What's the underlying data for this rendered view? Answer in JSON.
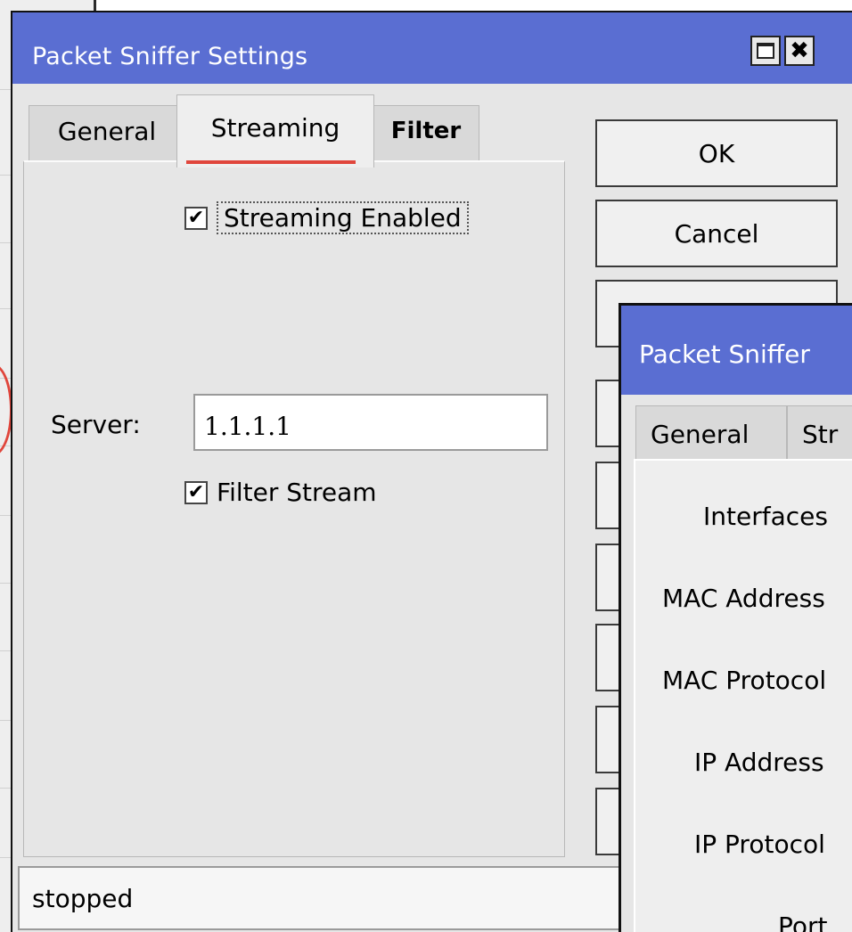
{
  "main_window": {
    "title": "Packet Sniffer Settings",
    "tabs": [
      {
        "label": "General"
      },
      {
        "label": "Streaming"
      },
      {
        "label": "Filter"
      }
    ],
    "streaming_enabled": {
      "label": "Streaming Enabled",
      "checked": true
    },
    "server": {
      "label": "Server:",
      "value": "1.1.1.1"
    },
    "filter_stream": {
      "label": "Filter Stream",
      "checked": true
    },
    "buttons": {
      "ok": "OK",
      "cancel": "Cancel"
    },
    "status": "stopped"
  },
  "second_window": {
    "title": "Packet Sniffer",
    "tabs": [
      {
        "label": "General"
      },
      {
        "label": "Str"
      }
    ],
    "fields": [
      {
        "label": "Interfaces"
      },
      {
        "label": "MAC Address"
      },
      {
        "label": "MAC Protocol"
      },
      {
        "label": "IP Address"
      },
      {
        "label": "IP Protocol"
      },
      {
        "label": "Port"
      }
    ]
  },
  "colors": {
    "title_bar": "#5a6ed2",
    "tab_underline": "#e0463c"
  },
  "icons": {
    "maximize": "maximize-icon",
    "close": "close-icon",
    "check": "checkmark-icon"
  }
}
